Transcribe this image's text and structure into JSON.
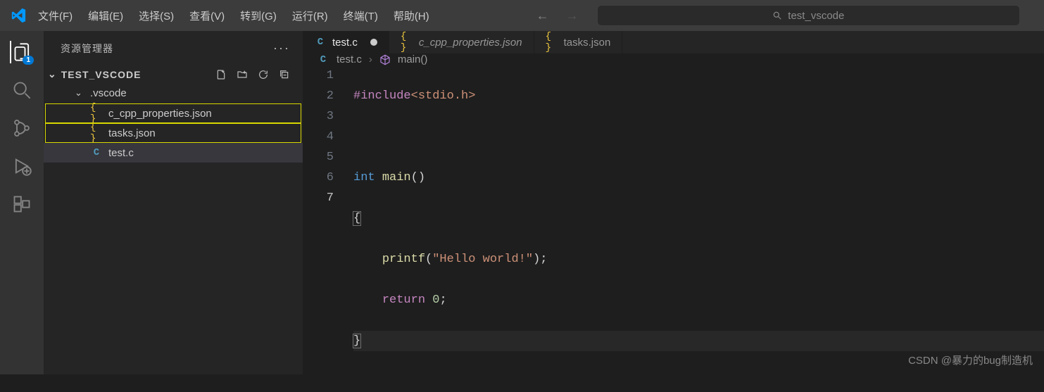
{
  "menu": [
    "文件(F)",
    "编辑(E)",
    "选择(S)",
    "查看(V)",
    "转到(G)",
    "运行(R)",
    "终端(T)",
    "帮助(H)"
  ],
  "search_placeholder": "test_vscode",
  "sidebar": {
    "title": "资源管理器",
    "root": "TEST_VSCODE",
    "folder": ".vscode",
    "files_nested": [
      "c_cpp_properties.json",
      "tasks.json"
    ],
    "file_c": "test.c",
    "explorer_badge": "1"
  },
  "tabs": [
    {
      "label": "test.c",
      "icon": "c",
      "active": true,
      "dirty": true
    },
    {
      "label": "c_cpp_properties.json",
      "icon": "json",
      "active": false,
      "dirty": false
    },
    {
      "label": "tasks.json",
      "icon": "json",
      "active": false,
      "dirty": false
    }
  ],
  "breadcrumb": {
    "file": "test.c",
    "symbol": "main()"
  },
  "code": {
    "line_nums": [
      "1",
      "2",
      "3",
      "4",
      "5",
      "6",
      "7"
    ],
    "l1_inc": "#include",
    "l1_hdr": "<stdio.h>",
    "l3_ty": "int",
    "l3_fn": "main",
    "l3_par": "()",
    "l4": "{",
    "l5_fn": "printf",
    "l5_par1": "(",
    "l5_str": "\"Hello world!\"",
    "l5_par2": ");",
    "l6_kw": "return",
    "l6_num": "0",
    "l6_semi": ";",
    "l7": "}"
  },
  "watermark": "CSDN @暴力的bug制造机"
}
